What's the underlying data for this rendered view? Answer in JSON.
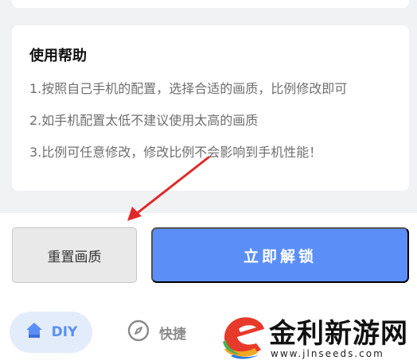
{
  "help": {
    "title": "使用帮助",
    "lines": [
      "1.按照自己手机的配置，选择合适的画质，比例修改即可",
      "2.如手机配置太低不建议使用太高的画质",
      "3.比例可任意修改，修改比例不会影响到手机性能！"
    ]
  },
  "actions": {
    "reset_label": "重置画质",
    "unlock_label": "立即解锁"
  },
  "tabs": [
    {
      "label": "DIY",
      "icon": "home-icon",
      "active": true
    },
    {
      "label": "快捷",
      "icon": "compass-icon",
      "active": false
    }
  ],
  "watermark": {
    "name": "金利新游网",
    "url": "www.jlnseeds.com"
  },
  "colors": {
    "accent": "#5b8ef7",
    "annotation_arrow": "#e02a2a"
  }
}
